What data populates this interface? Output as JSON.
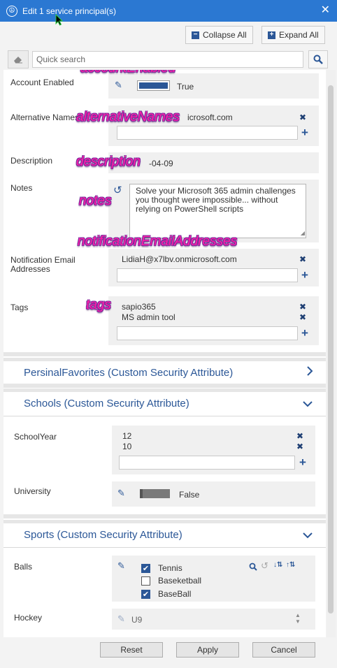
{
  "window": {
    "title": "Edit 1 service principal(s)",
    "close_glyph": "✕"
  },
  "toolbar": {
    "collapse_all": "Collapse All",
    "expand_all": "Expand All"
  },
  "search": {
    "placeholder": "Quick search"
  },
  "fields": {
    "account_enabled": {
      "label": "Account Enabled",
      "value": "True",
      "overlay": "accountEnabled"
    },
    "alternative_names": {
      "label": "Alternative Names",
      "value": "icrosoft.com",
      "overlay": "alternativeNames"
    },
    "description": {
      "label": "Description",
      "value": "-04-09",
      "overlay": "description"
    },
    "notes": {
      "label": "Notes",
      "value": "Solve your Microsoft 365 admin challenges you thought were impossible... without relying on PowerShell scripts",
      "overlay": "notes"
    },
    "notification_email": {
      "label": "Notification Email Addresses",
      "values": [
        "LidiaH@x7lbv.onmicrosoft.com"
      ],
      "overlay": "notificationEmailAddresses"
    },
    "tags": {
      "label": "Tags",
      "values": [
        "sapio365",
        "MS admin tool"
      ],
      "overlay": "tags"
    }
  },
  "sections": {
    "persinal": {
      "title": "PersinalFavorites (Custom Security Attribute)"
    },
    "schools": {
      "title": "Schools (Custom Security Attribute)",
      "school_year": {
        "label": "SchoolYear",
        "values": [
          "12",
          "10"
        ]
      },
      "university": {
        "label": "University",
        "value": "False"
      }
    },
    "sports": {
      "title": "Sports (Custom Security Attribute)",
      "balls": {
        "label": "Balls",
        "options": [
          {
            "label": "Tennis",
            "checked": true
          },
          {
            "label": "Baseketball",
            "checked": false
          },
          {
            "label": "BaseBall",
            "checked": true
          }
        ]
      },
      "hockey": {
        "label": "Hockey",
        "value": "U9"
      }
    }
  },
  "footer": {
    "reset": "Reset",
    "apply": "Apply",
    "cancel": "Cancel"
  },
  "colors": {
    "titlebar": "#2b78d2",
    "accent": "#2b5797",
    "overlay_text": "#ff1ea8"
  }
}
